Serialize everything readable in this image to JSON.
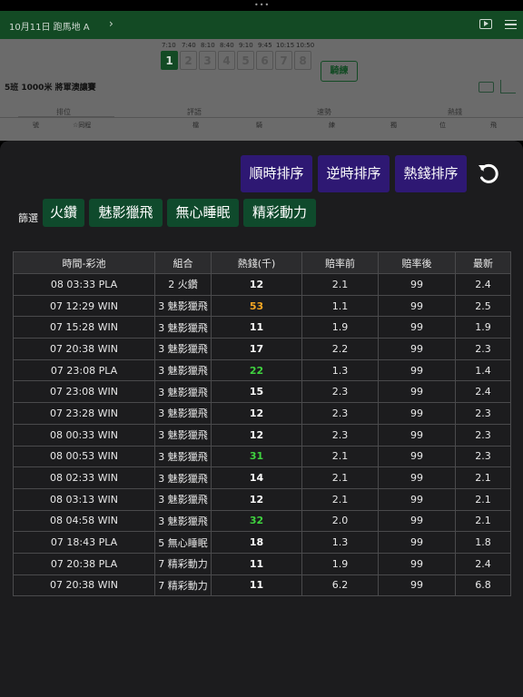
{
  "status_dots": "•••",
  "background": {
    "nav_title": "10月11日 跑馬地 A",
    "chevron": "›",
    "race_times": [
      "7:10",
      "7:40",
      "8:10",
      "8:40",
      "9:10",
      "9:45",
      "10:15",
      "10:50"
    ],
    "race_numbers": [
      "1",
      "2",
      "3",
      "4",
      "5",
      "6",
      "7",
      "8"
    ],
    "active_race": "1",
    "trainer_button": "騎練",
    "race_name": "5班 1000米 將軍澳讓賽",
    "tabs": [
      "排位",
      "評語",
      "速勢",
      "熱錢"
    ],
    "columns": [
      "號",
      "☆同程",
      "檔",
      "騎",
      "練",
      "獨",
      "位",
      "飛"
    ],
    "icons": [
      "video-icon",
      "menu-icon",
      "camera-icon",
      "chart-icon"
    ]
  },
  "sort_buttons": [
    "順時排序",
    "逆時排序",
    "熱錢排序"
  ],
  "refresh_icon": "refresh-icon",
  "filter": {
    "label": "篩選",
    "options": [
      "火鑽",
      "魅影獵飛",
      "無心睡眠",
      "精彩動力"
    ]
  },
  "table": {
    "headers": [
      "時間-彩池",
      "組合",
      "熱錢(千)",
      "賠率前",
      "賠率後",
      "最新"
    ],
    "rows": [
      {
        "time_pool": "08 03:33 PLA",
        "combo": "2 火鑽",
        "money": "12",
        "money_color": "#ffffff",
        "before": "2.1",
        "after": "99",
        "latest": "2.4"
      },
      {
        "time_pool": "07 12:29 WIN",
        "combo": "3 魅影獵飛",
        "money": "53",
        "money_color": "#f5a623",
        "before": "1.1",
        "after": "99",
        "latest": "2.5"
      },
      {
        "time_pool": "07 15:28 WIN",
        "combo": "3 魅影獵飛",
        "money": "11",
        "money_color": "#ffffff",
        "before": "1.9",
        "after": "99",
        "latest": "1.9"
      },
      {
        "time_pool": "07 20:38 WIN",
        "combo": "3 魅影獵飛",
        "money": "17",
        "money_color": "#ffffff",
        "before": "2.2",
        "after": "99",
        "latest": "2.3"
      },
      {
        "time_pool": "07 23:08 PLA",
        "combo": "3 魅影獵飛",
        "money": "22",
        "money_color": "#3fd23f",
        "before": "1.3",
        "after": "99",
        "latest": "1.4"
      },
      {
        "time_pool": "07 23:08 WIN",
        "combo": "3 魅影獵飛",
        "money": "15",
        "money_color": "#ffffff",
        "before": "2.3",
        "after": "99",
        "latest": "2.4"
      },
      {
        "time_pool": "07 23:28 WIN",
        "combo": "3 魅影獵飛",
        "money": "12",
        "money_color": "#ffffff",
        "before": "2.3",
        "after": "99",
        "latest": "2.3"
      },
      {
        "time_pool": "08 00:33 WIN",
        "combo": "3 魅影獵飛",
        "money": "12",
        "money_color": "#ffffff",
        "before": "2.3",
        "after": "99",
        "latest": "2.3"
      },
      {
        "time_pool": "08 00:53 WIN",
        "combo": "3 魅影獵飛",
        "money": "31",
        "money_color": "#3fd23f",
        "before": "2.1",
        "after": "99",
        "latest": "2.3"
      },
      {
        "time_pool": "08 02:33 WIN",
        "combo": "3 魅影獵飛",
        "money": "14",
        "money_color": "#ffffff",
        "before": "2.1",
        "after": "99",
        "latest": "2.1"
      },
      {
        "time_pool": "08 03:13 WIN",
        "combo": "3 魅影獵飛",
        "money": "12",
        "money_color": "#ffffff",
        "before": "2.1",
        "after": "99",
        "latest": "2.1"
      },
      {
        "time_pool": "08 04:58 WIN",
        "combo": "3 魅影獵飛",
        "money": "32",
        "money_color": "#3fd23f",
        "before": "2.0",
        "after": "99",
        "latest": "2.1"
      },
      {
        "time_pool": "07 18:43 PLA",
        "combo": "5 無心睡眠",
        "money": "18",
        "money_color": "#ffffff",
        "before": "1.3",
        "after": "99",
        "latest": "1.8"
      },
      {
        "time_pool": "07 20:38 PLA",
        "combo": "7 精彩動力",
        "money": "11",
        "money_color": "#ffffff",
        "before": "1.9",
        "after": "99",
        "latest": "2.4"
      },
      {
        "time_pool": "07 20:38 WIN",
        "combo": "7 精彩動力",
        "money": "11",
        "money_color": "#ffffff",
        "before": "6.2",
        "after": "99",
        "latest": "6.8"
      }
    ]
  }
}
